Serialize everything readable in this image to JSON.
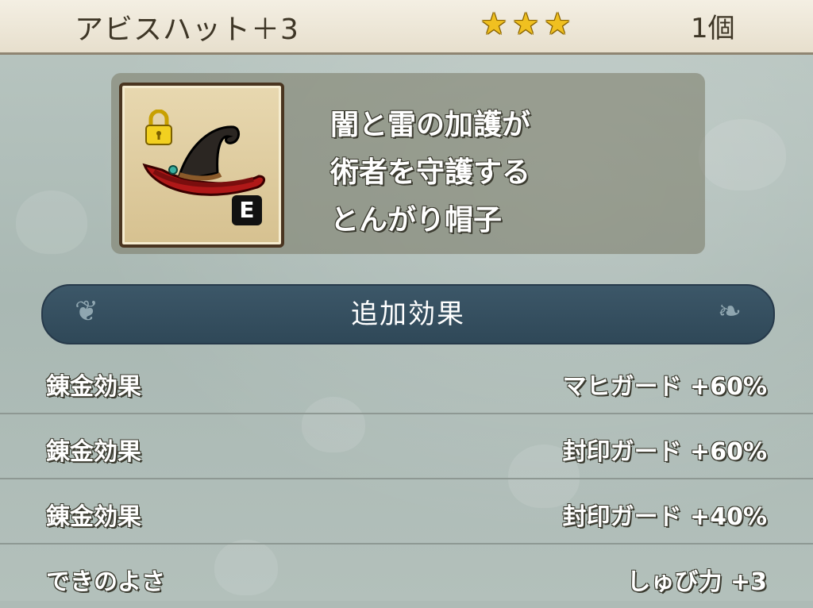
{
  "header": {
    "item_name": "アビスハット＋3",
    "stars": 3,
    "count": "1個"
  },
  "item": {
    "icon": "wizard-hat-icon",
    "locked": true,
    "equipped_badge": "E",
    "description": [
      "闇と雷の加護が",
      "術者を守護する",
      "とんがり帽子"
    ]
  },
  "section": {
    "title": "追加効果"
  },
  "effects": [
    {
      "label": "錬金効果",
      "value": "マヒガード +60%"
    },
    {
      "label": "錬金効果",
      "value": "封印ガード +60%"
    },
    {
      "label": "錬金効果",
      "value": "封印ガード +40%"
    },
    {
      "label": "できのよさ",
      "value": "しゅび力 +3"
    }
  ],
  "colors": {
    "header_bg": "#f4efe3",
    "banner_bg": "#3c5768",
    "star": "#f0c020",
    "hat_brim": "#b01818"
  }
}
